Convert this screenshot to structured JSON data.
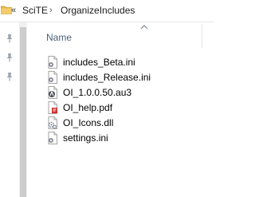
{
  "breadcrumb": {
    "overflow": "«",
    "parts": [
      "SciTE",
      "OrganizeIncludes"
    ],
    "separator": "›"
  },
  "file_list": {
    "column_header": "Name",
    "files": [
      {
        "name": "includes_Beta.ini",
        "icon": "ini-settings-file-icon"
      },
      {
        "name": "includes_Release.ini",
        "icon": "ini-settings-file-icon"
      },
      {
        "name": "OI_1.0.0.50.au3",
        "icon": "autoit-script-icon"
      },
      {
        "name": "OI_help.pdf",
        "icon": "pdf-file-icon"
      },
      {
        "name": "OI_Icons.dll",
        "icon": "dll-file-icon"
      },
      {
        "name": "settings.ini",
        "icon": "ini-settings-file-icon"
      }
    ]
  },
  "colors": {
    "header_text": "#4c607a",
    "folder_yellow": "#e8b84a",
    "pdf_red": "#d0312d"
  }
}
